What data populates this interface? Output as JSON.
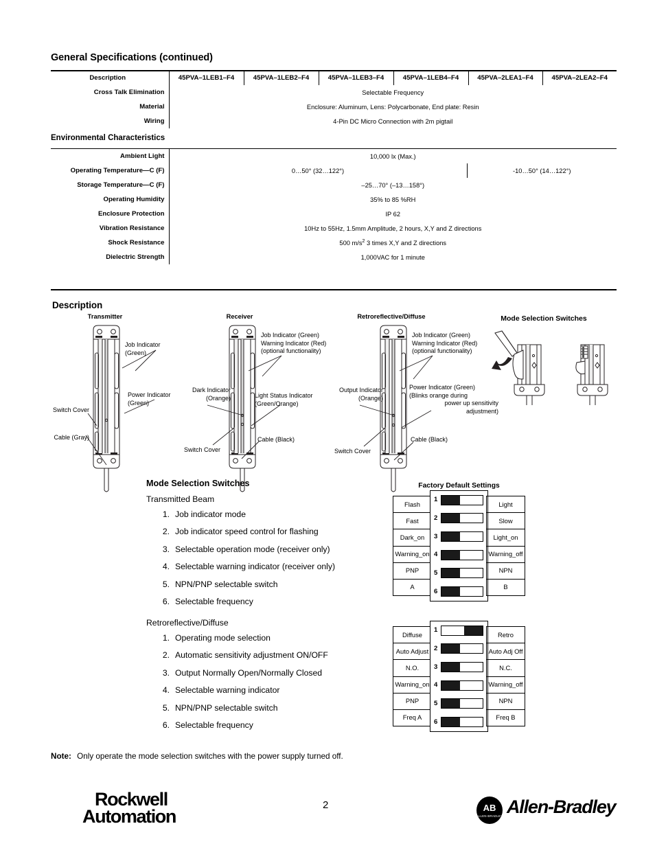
{
  "sections": {
    "general_specs_title": "General Specifications (continued)",
    "environmental_title": "Environmental Characteristics",
    "description_title": "Description"
  },
  "general_table": {
    "header_label": "Description",
    "columns": [
      "45PVA–1LEB1–F4",
      "45PVA–1LEB2–F4",
      "45PVA–1LEB3–F4",
      "45PVA–1LEB4–F4",
      "45PVA–2LEA1–F4",
      "45PVA–2LEA2–F4"
    ],
    "rows": [
      {
        "label": "Cross Talk Elimination",
        "value": "Selectable Frequency"
      },
      {
        "label": "Material",
        "value": "Enclosure: Aluminum,  Lens: Polycarbonate, End plate: Resin"
      },
      {
        "label": "Wiring",
        "value": "4-Pin DC Micro Connection with 2m pigtail"
      }
    ]
  },
  "environmental_table": {
    "rows": [
      {
        "label": "Ambient Light",
        "value": "10,000 lx (Max.)"
      },
      {
        "label": "Operating Temperature—C (F)",
        "value": "0…50° (32…122°)",
        "value2": "-10…50° (14…122°)",
        "split": true
      },
      {
        "label": "Storage Temperature—C (F)",
        "value": "–25…70° (–13…158°)"
      },
      {
        "label": "Operating Humidity",
        "value": "35% to 85 %RH"
      },
      {
        "label": "Enclosure Protection",
        "value": "IP 62"
      },
      {
        "label": "Vibration Resistance",
        "value": "10Hz to 55Hz, 1.5mm Amplitude, 2 hours, X,Y and Z directions"
      },
      {
        "label": "Shock Resistance",
        "value_pre": "500 m/s",
        "value_sup": "2",
        "value_post": " 3 times X,Y and Z directions",
        "rich": true
      },
      {
        "label": "Dielectric Strength",
        "value": "1,000VAC for 1 minute"
      }
    ]
  },
  "figures": {
    "transmitter": {
      "caption": "Transmitter",
      "job_indicator": "Job Indicator\n(Green)",
      "job_indicator_l1": "Job Indicator",
      "job_indicator_l2": "(Green)",
      "power_indicator_l1": "Power Indicator",
      "power_indicator_l2": "(Green)",
      "switch_cover": "Switch Cover",
      "cable": "Cable (Gray)"
    },
    "receiver": {
      "caption": "Receiver",
      "job_l1": "Job Indicator (Green)",
      "job_l2": "Warning Indicator (Red)",
      "job_l3": "(optional functionality)",
      "dark_l1": "Dark Indicator",
      "dark_l2": "(Orange)",
      "light_l1": "Light Status Indicator",
      "light_l2": "(Green/Orange)",
      "switch_cover": "Switch Cover",
      "cable": "Cable (Black)"
    },
    "retro": {
      "caption": "Retroreflective/Diffuse",
      "job_l1": "Job Indicator (Green)",
      "job_l2": "Warning Indicator (Red)",
      "job_l3": "(optional functionality)",
      "output_l1": "Output Indicator",
      "output_l2": "(Orange)",
      "power_l1": "Power Indicator (Green)",
      "power_l2": "(Blinks orange during",
      "power_l3": "power up sensitivity",
      "power_l4": "adjustment)",
      "switch_cover": "Switch Cover",
      "cable": "Cable (Black)"
    },
    "mode_switches_fig": {
      "caption": "Mode Selection Switches"
    }
  },
  "mode_selection": {
    "title": "Mode Selection Switches",
    "transmitted_beam_label": "Transmitted Beam",
    "transmitted_beam_items": [
      "Job indicator mode",
      "Job indicator speed control for flashing",
      "Selectable operation mode (receiver only)",
      "Selectable warning indicator (receiver only)",
      "NPN/PNP selectable switch",
      "Selectable frequency"
    ],
    "retro_label": "Retroreflective/Diffuse",
    "retro_items": [
      "Operating mode selection",
      "Automatic sensitivity adjustment ON/OFF",
      "Output Normally Open/Normally Closed",
      "Selectable warning indicator",
      "NPN/PNP selectable switch",
      "Selectable frequency"
    ]
  },
  "dip_tables": [
    {
      "title": "Factory Default Settings",
      "rows": [
        {
          "left": "Flash",
          "index": "1",
          "position": "left",
          "right": "Light"
        },
        {
          "left": "Fast",
          "index": "2",
          "position": "left",
          "right": "Slow"
        },
        {
          "left": "Dark_on",
          "index": "3",
          "position": "left",
          "right": "Light_on"
        },
        {
          "left": "Warning_on",
          "index": "4",
          "position": "left",
          "right": "Warning_off"
        },
        {
          "left": "PNP",
          "index": "5",
          "position": "left",
          "right": "NPN"
        },
        {
          "left": "A",
          "index": "6",
          "position": "left",
          "right": "B"
        }
      ]
    },
    {
      "title": "",
      "rows": [
        {
          "left": "Diffuse",
          "index": "1",
          "position": "right",
          "right": "Retro"
        },
        {
          "left": "Auto Adjust",
          "index": "2",
          "position": "left",
          "right": "Auto Adj Off"
        },
        {
          "left": "N.O.",
          "index": "3",
          "position": "left",
          "right": "N.C."
        },
        {
          "left": "Warning_on",
          "index": "4",
          "position": "left",
          "right": "Warning_off"
        },
        {
          "left": "PNP",
          "index": "5",
          "position": "left",
          "right": "NPN"
        },
        {
          "left": "Freq A",
          "index": "6",
          "position": "left",
          "right": "Freq B"
        }
      ]
    }
  ],
  "note": {
    "label": "Note:",
    "text": "Only operate the mode selection switches with the power supply turned off."
  },
  "footer": {
    "rockwell_l1": "Rockwell",
    "rockwell_l2": "Automation",
    "page_number": "2",
    "ab_mark": "AB",
    "ab_sub": "ALLEN-BRADLEY",
    "allen_bradley": "Allen-Bradley"
  }
}
